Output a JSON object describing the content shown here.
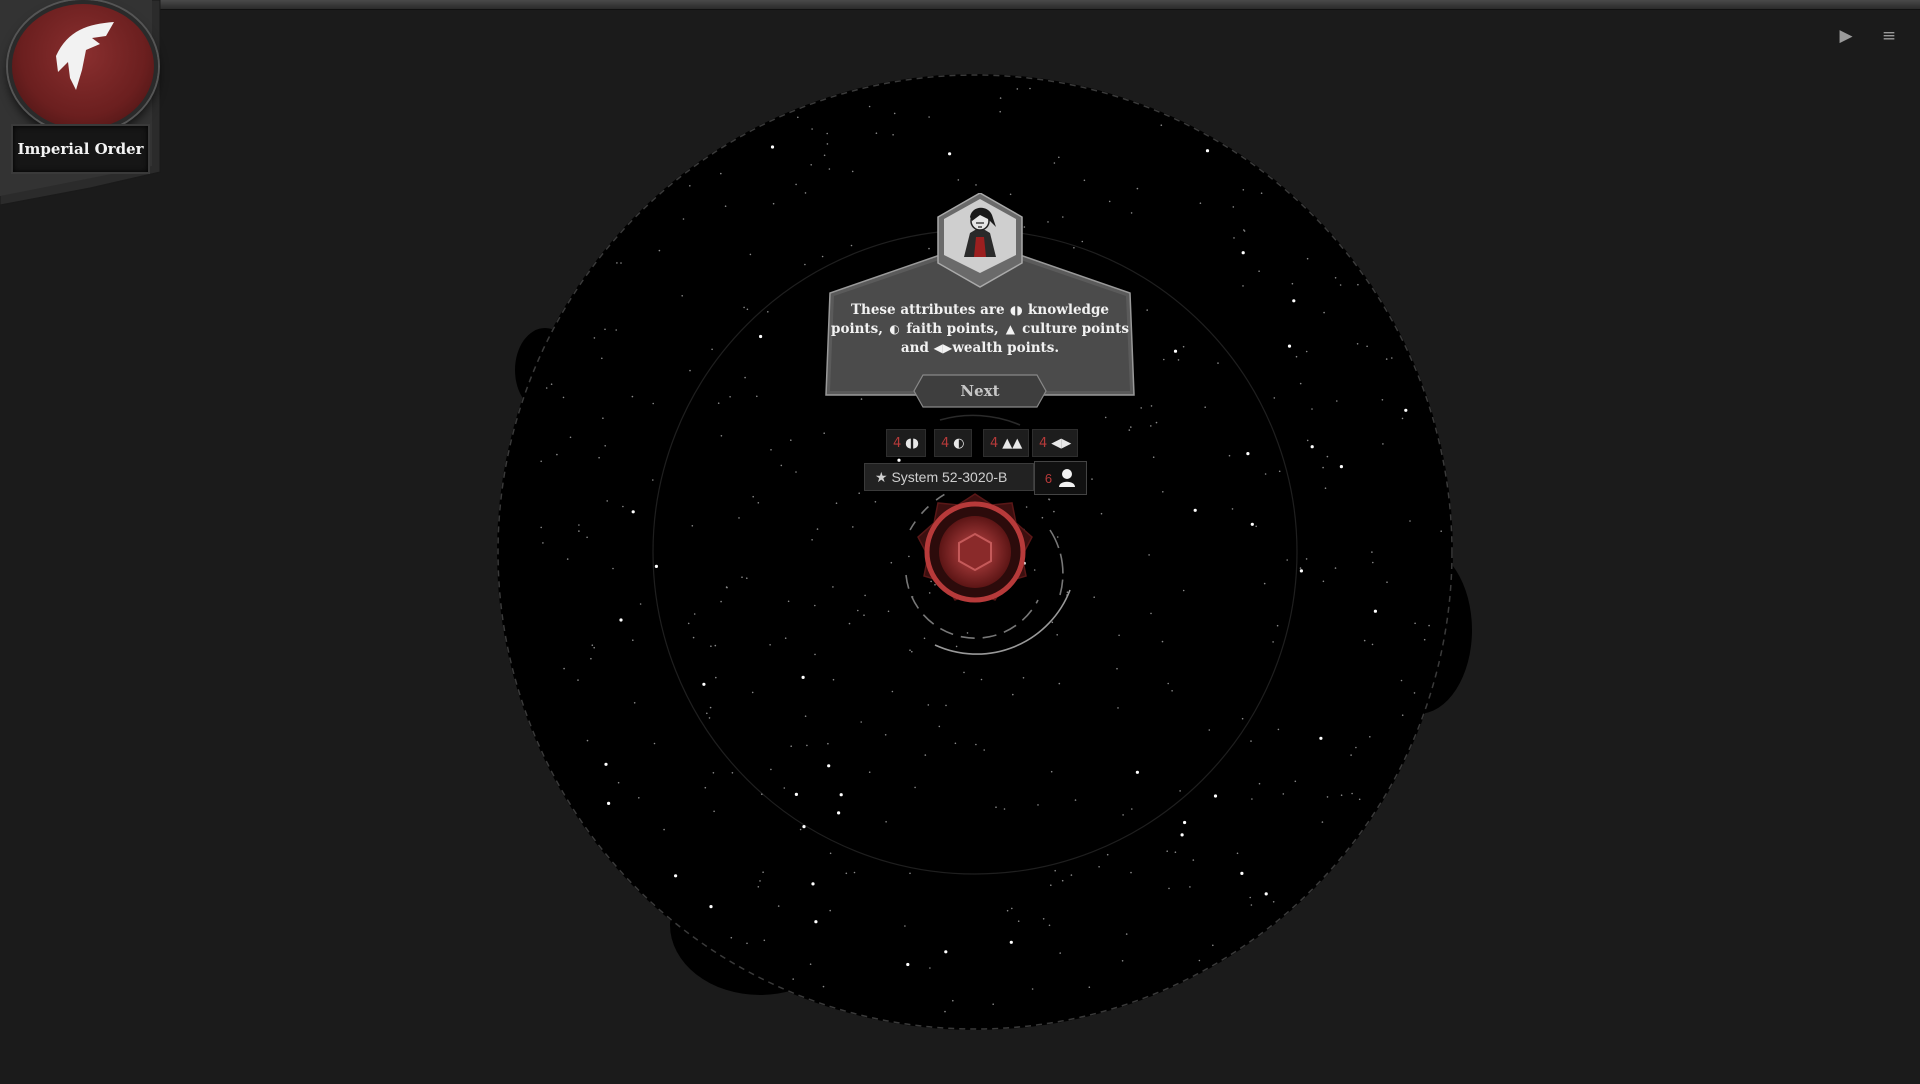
{
  "faction": {
    "name": "Imperial Order",
    "emblem_icon": "eagle-wing-icon",
    "color": "#7a2424"
  },
  "top_controls": {
    "play_icon": "▶",
    "menu_icon": "≡"
  },
  "tutorial": {
    "text_parts": {
      "p1": "These attributes are",
      "p2": "knowledge points,",
      "p3": "faith points,",
      "p4": "culture points and",
      "p5": "wealth",
      "p6": "points."
    },
    "next_label": "Next"
  },
  "system": {
    "name": "★ System 52-3020-B",
    "population": "6",
    "attributes": [
      {
        "value": "4",
        "type": "knowledge",
        "icon": "knowledge-icon",
        "glyph": "◖◗"
      },
      {
        "value": "4",
        "type": "faith",
        "icon": "faith-icon",
        "glyph": "◐"
      },
      {
        "value": "4",
        "type": "culture",
        "icon": "culture-icon",
        "glyph": "▲▲"
      },
      {
        "value": "4",
        "type": "wealth",
        "icon": "wealth-icon",
        "glyph": "◀▶"
      }
    ]
  },
  "colors": {
    "accent_red": "#b73a3a",
    "background": "#1b1b1b",
    "space": "#000000"
  }
}
